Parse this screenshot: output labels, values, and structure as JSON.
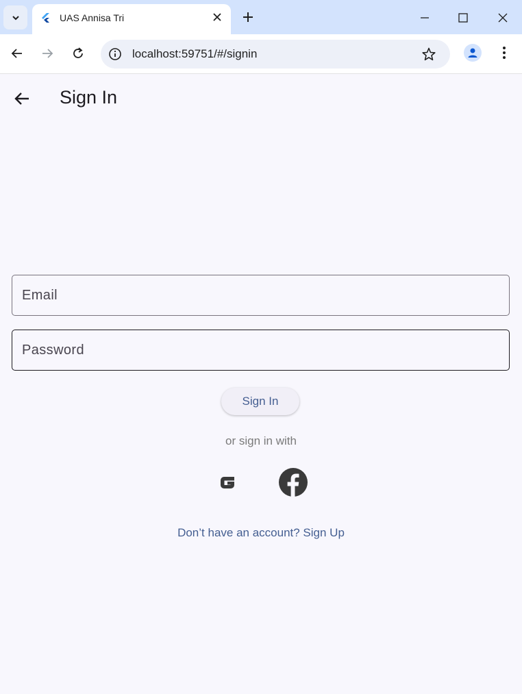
{
  "browser": {
    "tab_title": "UAS Annisa Tri",
    "url": "localhost:59751/#/signin"
  },
  "app": {
    "title": "Sign In",
    "email_placeholder": "Email",
    "password_placeholder": "Password",
    "signin_label": "Sign In",
    "or_text": "or sign in with",
    "signup_text": "Don’t have an account? Sign Up"
  },
  "colors": {
    "accent": "#445e91",
    "background": "#f8f7fd",
    "tabstrip": "#d3e3fd"
  }
}
